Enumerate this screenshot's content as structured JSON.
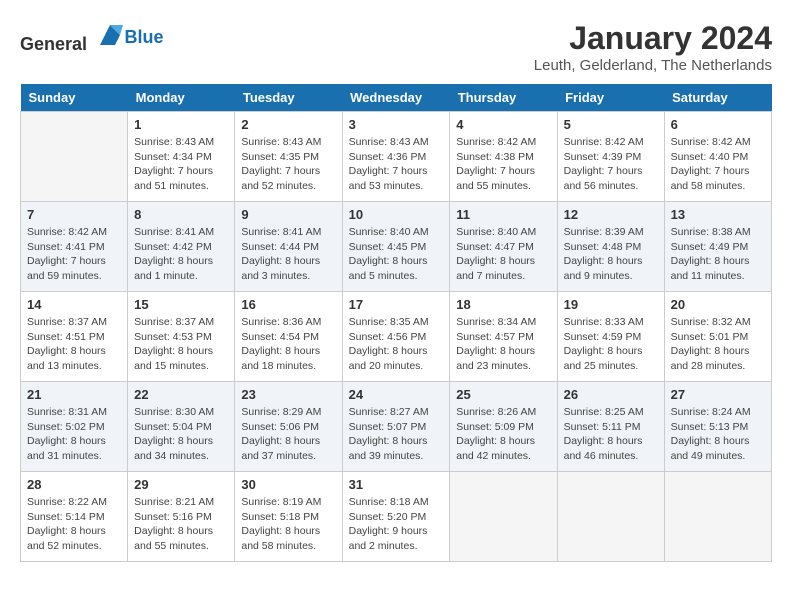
{
  "header": {
    "logo_general": "General",
    "logo_blue": "Blue",
    "month_title": "January 2024",
    "subtitle": "Leuth, Gelderland, The Netherlands"
  },
  "calendar": {
    "days_of_week": [
      "Sunday",
      "Monday",
      "Tuesday",
      "Wednesday",
      "Thursday",
      "Friday",
      "Saturday"
    ],
    "weeks": [
      [
        {
          "day": "",
          "info": ""
        },
        {
          "day": "1",
          "info": "Sunrise: 8:43 AM\nSunset: 4:34 PM\nDaylight: 7 hours\nand 51 minutes."
        },
        {
          "day": "2",
          "info": "Sunrise: 8:43 AM\nSunset: 4:35 PM\nDaylight: 7 hours\nand 52 minutes."
        },
        {
          "day": "3",
          "info": "Sunrise: 8:43 AM\nSunset: 4:36 PM\nDaylight: 7 hours\nand 53 minutes."
        },
        {
          "day": "4",
          "info": "Sunrise: 8:42 AM\nSunset: 4:38 PM\nDaylight: 7 hours\nand 55 minutes."
        },
        {
          "day": "5",
          "info": "Sunrise: 8:42 AM\nSunset: 4:39 PM\nDaylight: 7 hours\nand 56 minutes."
        },
        {
          "day": "6",
          "info": "Sunrise: 8:42 AM\nSunset: 4:40 PM\nDaylight: 7 hours\nand 58 minutes."
        }
      ],
      [
        {
          "day": "7",
          "info": "Sunrise: 8:42 AM\nSunset: 4:41 PM\nDaylight: 7 hours\nand 59 minutes."
        },
        {
          "day": "8",
          "info": "Sunrise: 8:41 AM\nSunset: 4:42 PM\nDaylight: 8 hours\nand 1 minute."
        },
        {
          "day": "9",
          "info": "Sunrise: 8:41 AM\nSunset: 4:44 PM\nDaylight: 8 hours\nand 3 minutes."
        },
        {
          "day": "10",
          "info": "Sunrise: 8:40 AM\nSunset: 4:45 PM\nDaylight: 8 hours\nand 5 minutes."
        },
        {
          "day": "11",
          "info": "Sunrise: 8:40 AM\nSunset: 4:47 PM\nDaylight: 8 hours\nand 7 minutes."
        },
        {
          "day": "12",
          "info": "Sunrise: 8:39 AM\nSunset: 4:48 PM\nDaylight: 8 hours\nand 9 minutes."
        },
        {
          "day": "13",
          "info": "Sunrise: 8:38 AM\nSunset: 4:49 PM\nDaylight: 8 hours\nand 11 minutes."
        }
      ],
      [
        {
          "day": "14",
          "info": "Sunrise: 8:37 AM\nSunset: 4:51 PM\nDaylight: 8 hours\nand 13 minutes."
        },
        {
          "day": "15",
          "info": "Sunrise: 8:37 AM\nSunset: 4:53 PM\nDaylight: 8 hours\nand 15 minutes."
        },
        {
          "day": "16",
          "info": "Sunrise: 8:36 AM\nSunset: 4:54 PM\nDaylight: 8 hours\nand 18 minutes."
        },
        {
          "day": "17",
          "info": "Sunrise: 8:35 AM\nSunset: 4:56 PM\nDaylight: 8 hours\nand 20 minutes."
        },
        {
          "day": "18",
          "info": "Sunrise: 8:34 AM\nSunset: 4:57 PM\nDaylight: 8 hours\nand 23 minutes."
        },
        {
          "day": "19",
          "info": "Sunrise: 8:33 AM\nSunset: 4:59 PM\nDaylight: 8 hours\nand 25 minutes."
        },
        {
          "day": "20",
          "info": "Sunrise: 8:32 AM\nSunset: 5:01 PM\nDaylight: 8 hours\nand 28 minutes."
        }
      ],
      [
        {
          "day": "21",
          "info": "Sunrise: 8:31 AM\nSunset: 5:02 PM\nDaylight: 8 hours\nand 31 minutes."
        },
        {
          "day": "22",
          "info": "Sunrise: 8:30 AM\nSunset: 5:04 PM\nDaylight: 8 hours\nand 34 minutes."
        },
        {
          "day": "23",
          "info": "Sunrise: 8:29 AM\nSunset: 5:06 PM\nDaylight: 8 hours\nand 37 minutes."
        },
        {
          "day": "24",
          "info": "Sunrise: 8:27 AM\nSunset: 5:07 PM\nDaylight: 8 hours\nand 39 minutes."
        },
        {
          "day": "25",
          "info": "Sunrise: 8:26 AM\nSunset: 5:09 PM\nDaylight: 8 hours\nand 42 minutes."
        },
        {
          "day": "26",
          "info": "Sunrise: 8:25 AM\nSunset: 5:11 PM\nDaylight: 8 hours\nand 46 minutes."
        },
        {
          "day": "27",
          "info": "Sunrise: 8:24 AM\nSunset: 5:13 PM\nDaylight: 8 hours\nand 49 minutes."
        }
      ],
      [
        {
          "day": "28",
          "info": "Sunrise: 8:22 AM\nSunset: 5:14 PM\nDaylight: 8 hours\nand 52 minutes."
        },
        {
          "day": "29",
          "info": "Sunrise: 8:21 AM\nSunset: 5:16 PM\nDaylight: 8 hours\nand 55 minutes."
        },
        {
          "day": "30",
          "info": "Sunrise: 8:19 AM\nSunset: 5:18 PM\nDaylight: 8 hours\nand 58 minutes."
        },
        {
          "day": "31",
          "info": "Sunrise: 8:18 AM\nSunset: 5:20 PM\nDaylight: 9 hours\nand 2 minutes."
        },
        {
          "day": "",
          "info": ""
        },
        {
          "day": "",
          "info": ""
        },
        {
          "day": "",
          "info": ""
        }
      ]
    ]
  }
}
